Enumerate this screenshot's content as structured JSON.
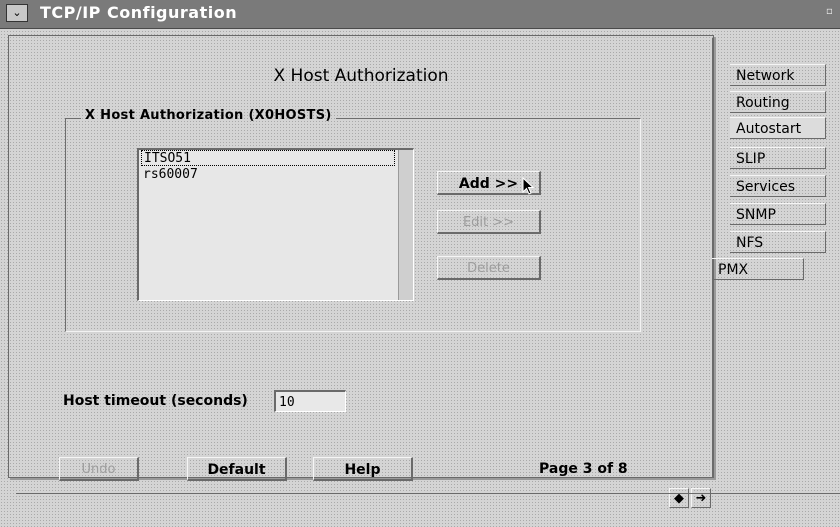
{
  "window": {
    "title": "TCP/IP Configuration",
    "sysmenu_glyph": "⌄",
    "min_glyph": "▫"
  },
  "page": {
    "heading": "X Host Authorization",
    "group_label": "X Host Authorization (X0HOSTS)",
    "hosts": [
      "ITSO51",
      "rs60007"
    ],
    "buttons": {
      "add": "Add >>",
      "edit": "Edit >>",
      "delete": "Delete"
    },
    "timeout_label": "Host timeout (seconds)",
    "timeout_value": "10",
    "bottom_buttons": {
      "undo": "Undo",
      "default": "Default",
      "help": "Help"
    },
    "page_info": "Page 3 of 8",
    "nav": {
      "prev_glyph": "◆",
      "next_glyph": "➜"
    }
  },
  "tabs": [
    {
      "label": "Network"
    },
    {
      "label": "Routing"
    },
    {
      "label": "Autostart"
    },
    {
      "label": "SLIP"
    },
    {
      "label": "Services"
    },
    {
      "label": "SNMP"
    },
    {
      "label": "NFS"
    },
    {
      "label": "PMX"
    }
  ],
  "colors": {
    "titlebar": "#7a7a7a",
    "background": "#d4d4d4"
  }
}
